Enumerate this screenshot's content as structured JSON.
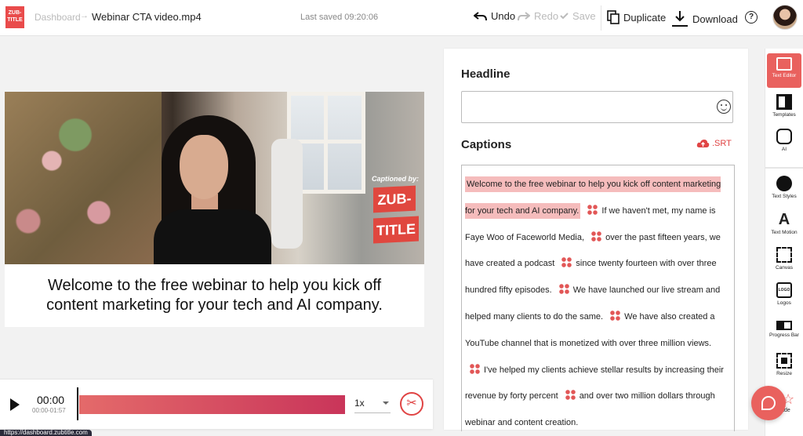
{
  "header": {
    "logo_line1": "ZUB-",
    "logo_line2": "TITLE",
    "breadcrumb_root": "Dashboard",
    "breadcrumb_arrow": "→",
    "file_name": "Webinar CTA video.mp4",
    "last_saved": "Last saved 09:20:06",
    "undo_label": "Undo",
    "redo_label": "Redo",
    "save_label": "Save",
    "duplicate_label": "Duplicate",
    "download_label": "Download",
    "help_symbol": "?"
  },
  "video": {
    "captioned_by": "Captioned by:",
    "badge_line1": "ZUB-",
    "badge_line2": "TITLE",
    "subtitle": "Welcome to the free webinar to help you kick off content marketing for your tech and AI company."
  },
  "player": {
    "current_time": "00:00",
    "range": "00:00-01:57",
    "speed": "1x",
    "progress": 0.0
  },
  "status_bar": {
    "url": "https://dashboard.zubtitle.com"
  },
  "editor": {
    "headline_label": "Headline",
    "headline_value": "",
    "captions_label": "Captions",
    "srt_label": ".SRT",
    "captions": [
      {
        "text": "Welcome to the free webinar to help you kick off content marketing for your tech and AI company.",
        "highlighted": true
      },
      {
        "text": "If we haven't met, my name is Faye Woo of Faceworld Media,",
        "highlighted": false
      },
      {
        "text": "over the past fifteen years, we have created a podcast",
        "highlighted": false
      },
      {
        "text": "since twenty fourteen with over three hundred fifty episodes.",
        "highlighted": false
      },
      {
        "text": "We have launched our live stream and helped many clients to do the same.",
        "highlighted": false
      },
      {
        "text": "We have also created a YouTube channel that is monetized with over three million views.",
        "highlighted": false
      },
      {
        "text": "I've helped my clients achieve stellar results by increasing their revenue by forty percent",
        "highlighted": false
      },
      {
        "text": "and over two million dollars through webinar and content creation.",
        "highlighted": false
      }
    ]
  },
  "sidebar": {
    "items": [
      {
        "label": "Text Editor",
        "icon": "text-editor-icon",
        "active": true
      },
      {
        "label": "Templates",
        "icon": "templates-icon"
      },
      {
        "label": "AI",
        "icon": "ai-icon"
      },
      {
        "label": "Text Styles",
        "icon": "palette-icon"
      },
      {
        "label": "Text Motion",
        "icon": "text-motion-icon"
      },
      {
        "label": "Canvas",
        "icon": "canvas-icon"
      },
      {
        "label": "Logos",
        "icon": "logo-icon"
      },
      {
        "label": "Progress Bar",
        "icon": "progress-bar-icon"
      },
      {
        "label": "Resize",
        "icon": "resize-icon"
      }
    ],
    "logo_icon_text": "LOGO",
    "upgrade_label": "pgrade"
  },
  "colors": {
    "accent": "#e9615e",
    "brand": "#e0473f",
    "track": "#c9355a"
  }
}
